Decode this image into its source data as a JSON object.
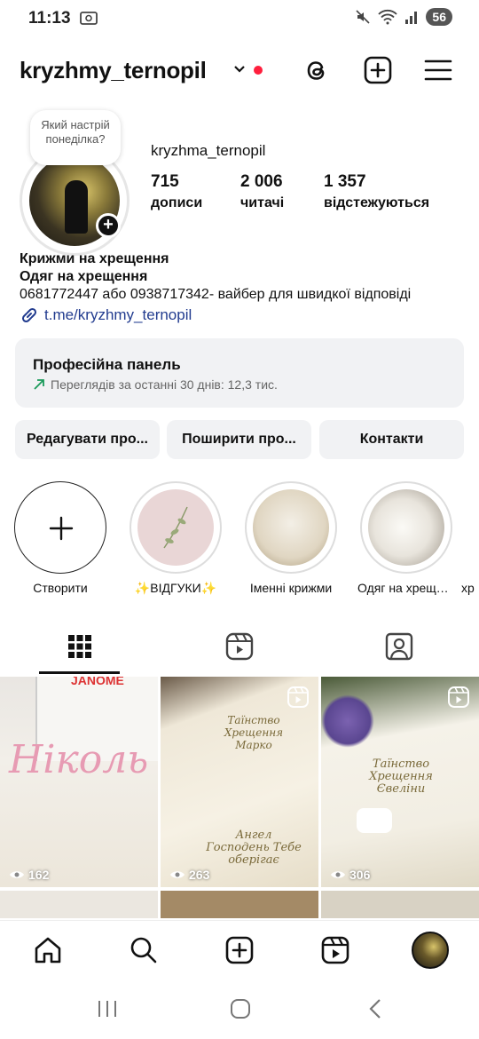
{
  "status": {
    "time": "11:13",
    "battery": "56"
  },
  "header": {
    "username": "kryzhmy_ternopil"
  },
  "profile": {
    "note": "Який настрій понеділка?",
    "handle": "kryzhma_ternopil",
    "stats": [
      {
        "num": "715",
        "label": "дописи"
      },
      {
        "num": "2 006",
        "label": "читачі"
      },
      {
        "num": "1 357",
        "label": "відстежуються"
      }
    ],
    "bio": {
      "line1": "Крижми на хрещення",
      "line2": "Одяг на хрещення",
      "line3": "0681772447 або 0938717342- вайбер для швидкої відповіді",
      "link": "t.me/kryzhmy_ternopil"
    }
  },
  "pro_panel": {
    "title": "Професійна панель",
    "subtitle": "Переглядів за останні 30 днів: 12,3 тис."
  },
  "buttons": {
    "edit": "Редагувати про...",
    "share": "Поширити про...",
    "contacts": "Контакти"
  },
  "highlights": [
    {
      "label": "Створити"
    },
    {
      "label": "✨ВІДГУКИ✨"
    },
    {
      "label": "Іменні крижми"
    },
    {
      "label": "Одяг на хрещен..."
    },
    {
      "label": "хр"
    }
  ],
  "grid": [
    {
      "views": "162",
      "text": "Ніколь",
      "brand": "JANOME"
    },
    {
      "views": "263",
      "text_top": "Таїнство Хрещення Марко",
      "text_bottom": "Ангел Господень Тебе оберігає"
    },
    {
      "views": "306",
      "text_top": "Таїнство Хрещення Євеліни"
    }
  ],
  "colors": {
    "link": "#223c8f",
    "accent_red": "#ff1f3d",
    "panel_bg": "#f1f2f4"
  }
}
